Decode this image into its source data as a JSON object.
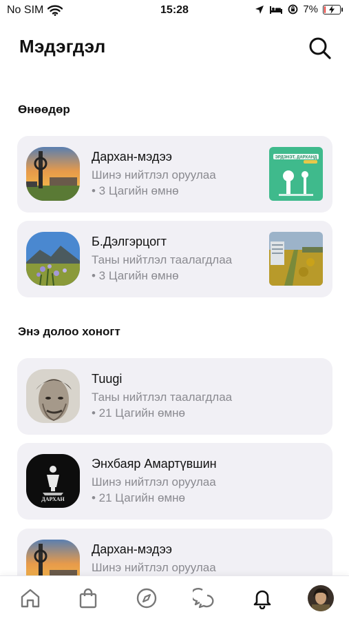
{
  "status_bar": {
    "carrier": "No SIM",
    "time": "15:28",
    "battery_text": "7%",
    "battery_level": 0.07,
    "battery_color": "#e53935"
  },
  "header": {
    "title": "Мэдэгдэл",
    "search_icon": "search-icon"
  },
  "sections": [
    {
      "title": "Өнөөдөр",
      "items": [
        {
          "name": "Дархан-мэдээ",
          "action": "Шинэ нийтлэл оруулаа",
          "time": "• 3 Цагийн өмнө"
        },
        {
          "name": "Б.Дэлгэрцогт",
          "action": "Таны нийтлэл таалагдлаа",
          "time": "• 3 Цагийн өмнө"
        }
      ]
    },
    {
      "title": "Энэ долоо хоногт",
      "items": [
        {
          "name": "Tuugi",
          "action": "Таны нийтлэл таалагдлаа",
          "time": "• 21 Цагийн өмнө"
        },
        {
          "name": "Энхбаяр Амартүвшин",
          "action": "Шинэ нийтлэл оруулаа",
          "time": "• 21 Цагийн өмнө"
        },
        {
          "name": "Дархан-мэдээ",
          "action": "Шинэ нийтлэл оруулаа",
          "time": ""
        }
      ]
    }
  ],
  "thumb_texts": {
    "darkhan_post_title": "ЭРДЭНЭТ, ДАРХАНД",
    "darkhan_logo_text": "ДАРХАН"
  },
  "tabbar": {
    "tabs": [
      "home-icon",
      "shopping-bag-icon",
      "compass-icon",
      "chat-icon",
      "bell-icon",
      "profile-avatar"
    ],
    "active": "bell-icon",
    "active_color": "#111111",
    "inactive_color": "#777777"
  }
}
